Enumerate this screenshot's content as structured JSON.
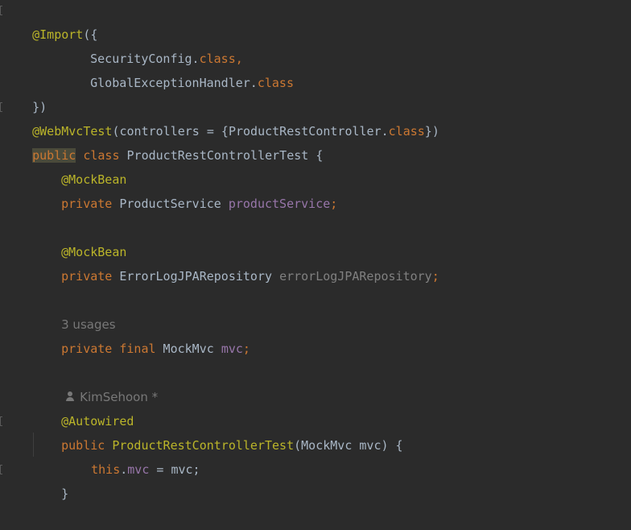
{
  "code": {
    "l1": {
      "ann": "@Import",
      "rest": "({"
    },
    "l2": {
      "name": "SecurityConfig.",
      "kw": "class",
      "tail": ","
    },
    "l3": {
      "name": "GlobalExceptionHandler.",
      "kw": "class"
    },
    "l4": {
      "text": "})"
    },
    "l5": {
      "ann": "@WebMvcTest",
      "a": "(controllers = {ProductRestController.",
      "kw": "class",
      "b": "})"
    },
    "l6": {
      "kw1": "public",
      "kw2": "class",
      "rest": " ProductRestControllerTest {"
    },
    "l7": {
      "ann": "@MockBean"
    },
    "l8": {
      "kw": "private",
      "type": " ProductService ",
      "field": "productService",
      "tail": ";"
    },
    "l10": {
      "ann": "@MockBean"
    },
    "l11": {
      "kw": "private",
      "type": " ErrorLogJPARepository ",
      "field": "errorLogJPARepository",
      "tail": ";"
    },
    "l13": {
      "hint": "3 usages"
    },
    "l14": {
      "kw": "private final",
      "type": " MockMvc ",
      "field": "mvc",
      "tail": ";"
    },
    "l16": {
      "author": "KimSehoon *"
    },
    "l17": {
      "ann": "@Autowired"
    },
    "l18": {
      "kw": "public",
      "name": "ProductRestControllerTest",
      "rest": "(MockMvc mvc) {"
    },
    "l19": {
      "kw": "this",
      "dot": ".",
      "field": "mvc",
      "rest": " = mvc;"
    },
    "l20": {
      "text": "}"
    }
  }
}
